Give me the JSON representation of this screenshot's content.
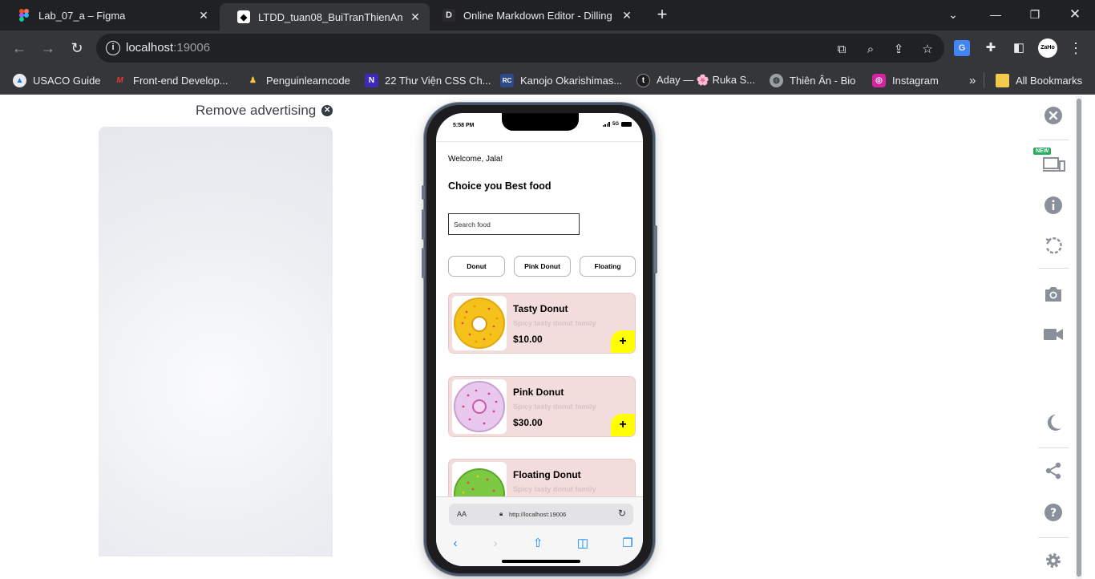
{
  "tabs": [
    {
      "title": "Lab_07_a – Figma",
      "favicon": "figma-icon",
      "color": "#f24e1e"
    },
    {
      "title": "LTDD_tuan08_BuiTranThienAn",
      "favicon": "expo-icon",
      "color": "#ffffff"
    },
    {
      "title": "Online Markdown Editor - Dilling",
      "favicon": "dillinger-icon",
      "color": "#2b2b2b"
    }
  ],
  "omnibox": {
    "host": "localhost",
    "port": ":19006"
  },
  "bookmarks": [
    {
      "label": "USACO Guide"
    },
    {
      "label": "Front-end Develop..."
    },
    {
      "label": "Penguinlearncode"
    },
    {
      "label": "22 Thư Viện CSS Ch..."
    },
    {
      "label": "Kanojo Okarishimas..."
    },
    {
      "label": "Aday — 🌸 Ruka S..."
    },
    {
      "label": "Thiên Ân - Bio"
    },
    {
      "label": "Instagram"
    }
  ],
  "bookmarks_overflow": "»",
  "all_bookmarks": "All Bookmarks",
  "ad": {
    "remove_label": "Remove advertising"
  },
  "phone": {
    "status_time": "5:58 PM",
    "network": "5G",
    "welcome": "Welcome, Jala!",
    "headline": "Choice you Best food",
    "search_placeholder": "Search food",
    "chips": [
      "Donut",
      "Pink Donut",
      "Floating"
    ],
    "cards": [
      {
        "name": "Tasty Donut",
        "desc": "Spicy tasty donut family",
        "price": "$10.00",
        "add": "+"
      },
      {
        "name": "Pink Donut",
        "desc": "Spicy tasty donut family",
        "price": "$30.00",
        "add": "+"
      },
      {
        "name": "Floating Donut",
        "desc": "Spicy tasty donut family",
        "price": "",
        "add": ""
      }
    ],
    "browser": {
      "aa": "AA",
      "url": "http://localhost:19006"
    }
  },
  "sidebar": {
    "new_badge": "NEW"
  },
  "colors": {
    "accent_yellow": "#ffff00",
    "card_bg": "#f3dcdc",
    "chrome_dark": "#202124"
  }
}
